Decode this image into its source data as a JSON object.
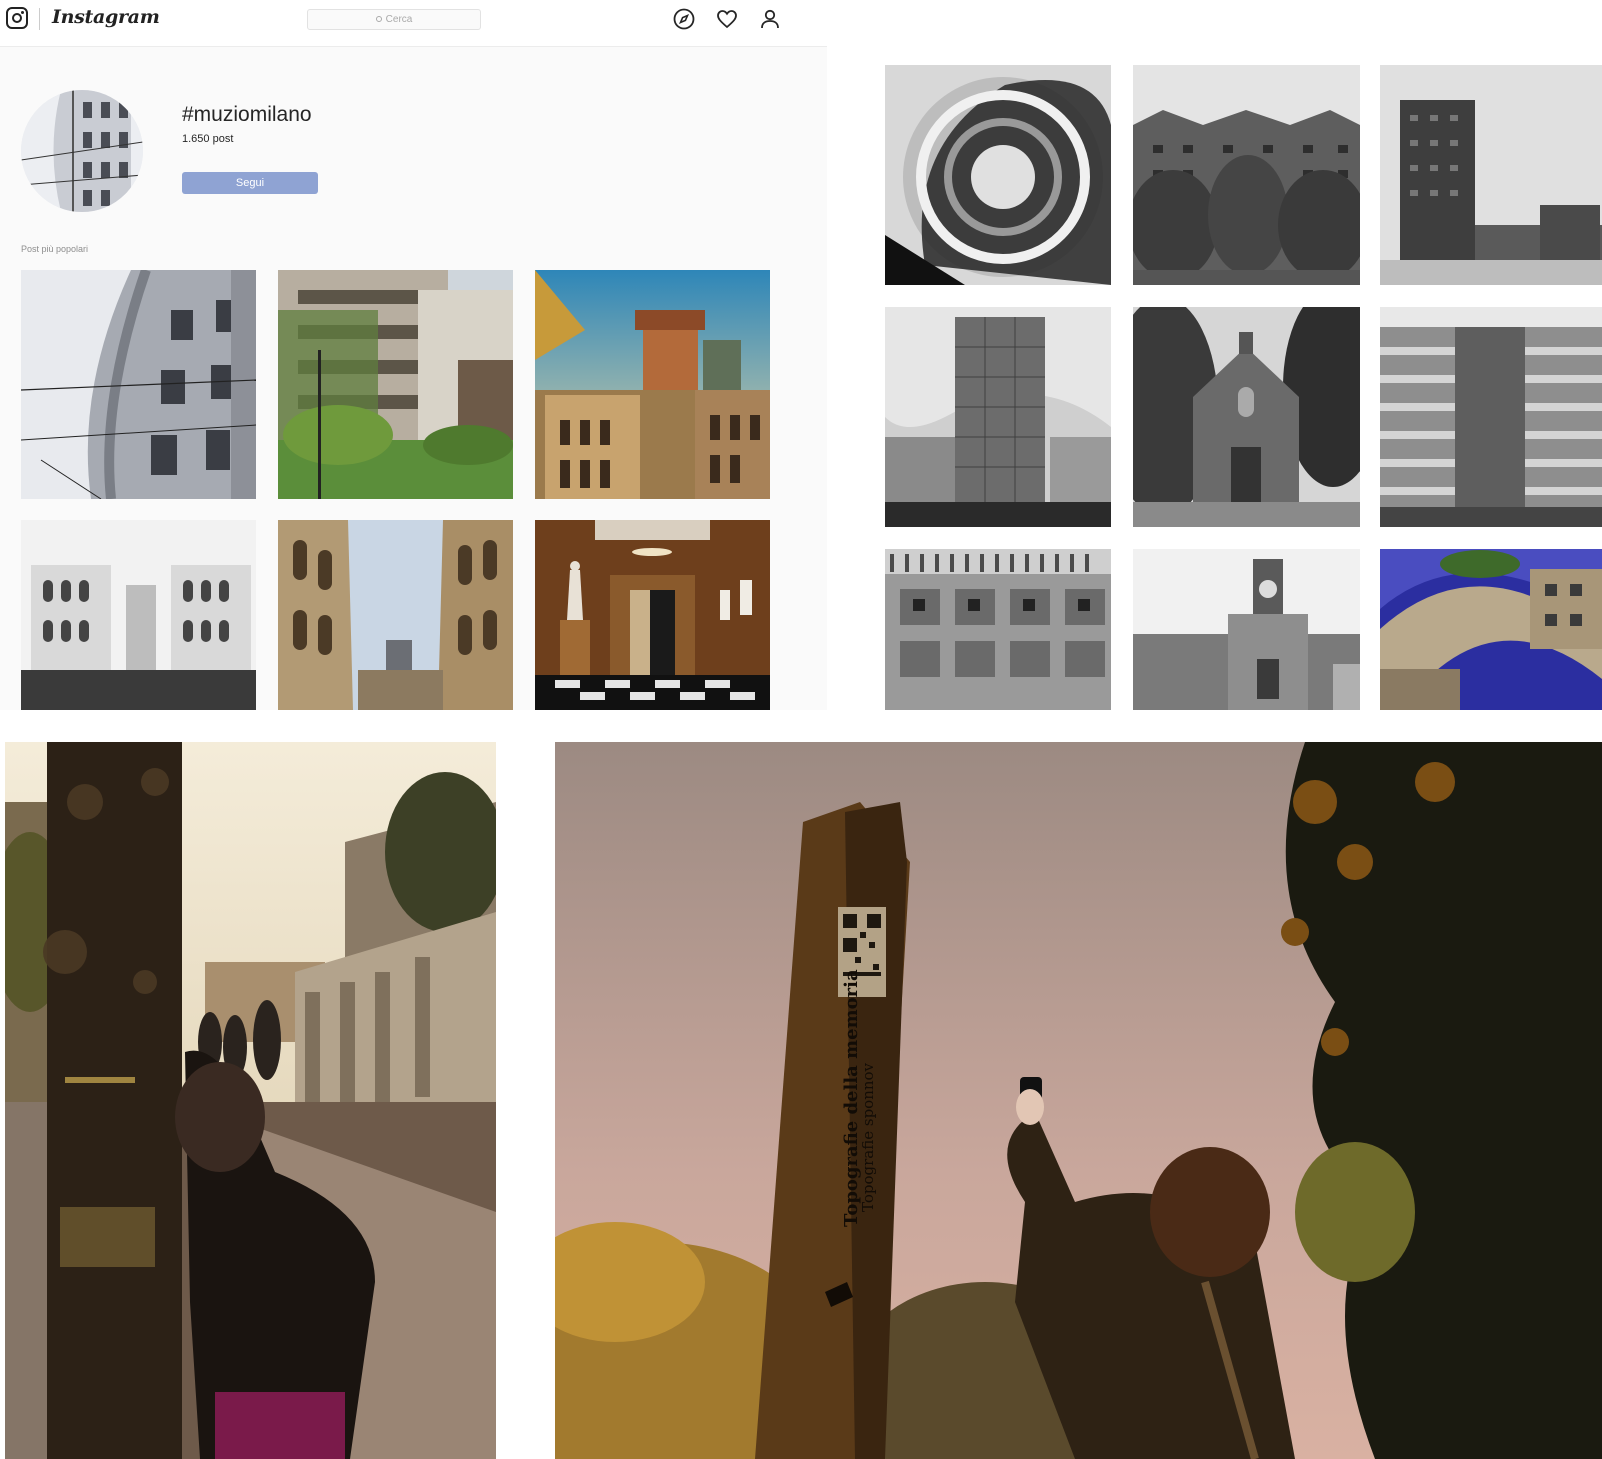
{
  "header": {
    "brand": "Instagram",
    "search_placeholder": "Cerca",
    "icons": [
      "compass-icon",
      "heart-icon",
      "user-icon"
    ]
  },
  "profile": {
    "hashtag": "#muziomilano",
    "post_count": "1.650 post",
    "follow_label": "Segui"
  },
  "section_label": "Post più popolari",
  "popular_posts": [
    {
      "subject": "building-curved-facade"
    },
    {
      "subject": "building-ivy-garden"
    },
    {
      "subject": "towers-sunset"
    },
    {
      "subject": "palazzi-crowd"
    },
    {
      "subject": "arches-street"
    },
    {
      "subject": "museum-corridor-statue"
    }
  ],
  "bw_grid": [
    {
      "subject": "spiral-staircase"
    },
    {
      "subject": "red-housing-trees"
    },
    {
      "subject": "tower-block"
    },
    {
      "subject": "tower-skyscraper"
    },
    {
      "subject": "church-facade"
    },
    {
      "subject": "apartment-grid"
    },
    {
      "subject": "colonnade-facade"
    },
    {
      "subject": "clock-tower"
    },
    {
      "subject": "bridge-arch-blue"
    }
  ],
  "totem_text": {
    "line1": "Topografie della memoria",
    "line2": "Topografie sponnov"
  },
  "colors": {
    "follow_button": "#8fa3d3",
    "page_bg": "#fafafa"
  }
}
